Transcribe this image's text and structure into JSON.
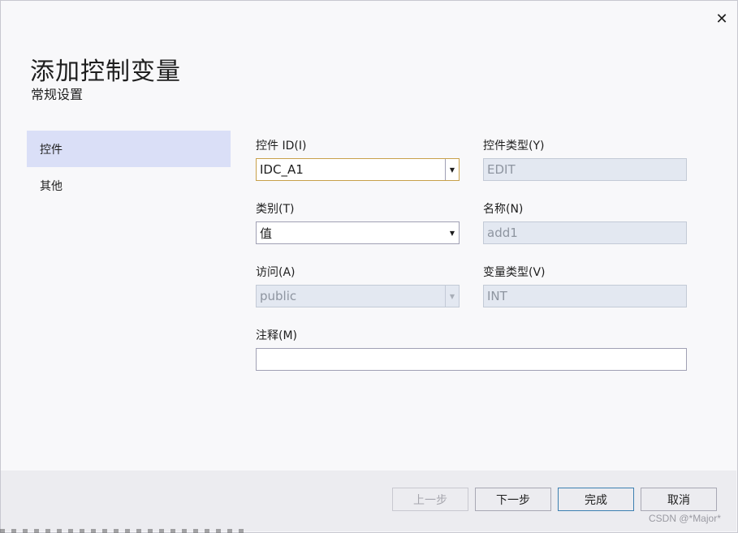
{
  "dialog": {
    "title": "添加控制变量",
    "subtitle": "常规设置",
    "close_glyph": "✕"
  },
  "nav": {
    "items": [
      {
        "label": "控件",
        "active": true
      },
      {
        "label": "其他",
        "active": false
      }
    ]
  },
  "form": {
    "control_id": {
      "label": "控件 ID(I)",
      "value": "IDC_A1"
    },
    "control_type": {
      "label": "控件类型(Y)",
      "value": "EDIT"
    },
    "category": {
      "label": "类别(T)",
      "value": "值"
    },
    "name": {
      "label": "名称(N)",
      "value": "add1"
    },
    "access": {
      "label": "访问(A)",
      "value": "public"
    },
    "variable_type": {
      "label": "变量类型(V)",
      "value": "INT"
    },
    "comment": {
      "label": "注释(M)",
      "value": ""
    }
  },
  "footer": {
    "prev_label": "上一步",
    "next_label": "下一步",
    "finish_label": "完成",
    "cancel_label": "取消"
  },
  "watermark": "CSDN @*Major*",
  "colors": {
    "nav_active_bg": "#dadff7",
    "disabled_bg": "#e3e8f1",
    "focus_border": "#c8a04a",
    "primary_border": "#3c7fb1"
  }
}
